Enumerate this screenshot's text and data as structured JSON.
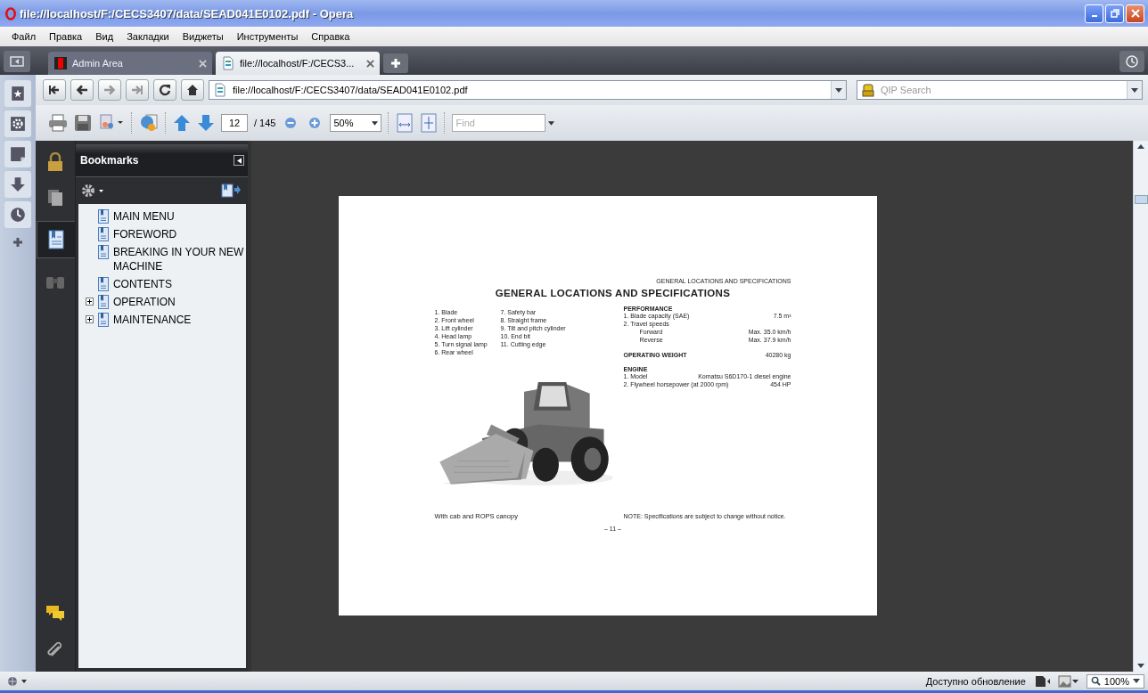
{
  "window": {
    "title": "file://localhost/F:/CECS3407/data/SEAD041E0102.pdf - Opera"
  },
  "menu": [
    "Файл",
    "Правка",
    "Вид",
    "Закладки",
    "Виджеты",
    "Инструменты",
    "Справка"
  ],
  "tabs": [
    {
      "label": "Admin Area",
      "selected": false
    },
    {
      "label": "file://localhost/F:/CECS3...",
      "selected": true
    }
  ],
  "address": {
    "value": "file://localhost/F:/CECS3407/data/SEAD041E0102.pdf"
  },
  "search": {
    "placeholder": "QIP Search"
  },
  "pdf_toolbar": {
    "page": "12",
    "total": "/ 145",
    "zoom": "50%",
    "find_placeholder": "Find"
  },
  "bookmarks": {
    "title": "Bookmarks",
    "items": [
      {
        "label": "MAIN MENU",
        "kind": "leaf"
      },
      {
        "label": "FOREWORD",
        "kind": "leaf"
      },
      {
        "label": "BREAKING IN YOUR NEW MACHINE",
        "kind": "leaf"
      },
      {
        "label": "CONTENTS",
        "kind": "leaf"
      },
      {
        "label": "OPERATION",
        "kind": "group",
        "expanded": false
      },
      {
        "label": "MAINTENANCE",
        "kind": "group",
        "expanded": false
      }
    ]
  },
  "document": {
    "running_head": "GENERAL LOCATIONS AND SPECIFICATIONS",
    "heading": "GENERAL LOCATIONS AND SPECIFICATIONS",
    "parts": [
      "1. Blade",
      "2. Front wheel",
      "3. Lift cylinder",
      "4. Head lamp",
      "5. Turn signal lamp",
      "6. Rear wheel",
      "7. Safety bar",
      "8. Straight frame",
      "9. Tilt and pitch cylinder",
      "10. End bit",
      "11. Cutting edge"
    ],
    "performance": {
      "heading": "PERFORMANCE",
      "rows": [
        {
          "label": "1. Blade capacity (SAE)",
          "value": "7.5 m³"
        },
        {
          "label": "2. Travel speeds",
          "children": [
            {
              "label": "Forward",
              "value": "Max. 35.0 km/h"
            },
            {
              "label": "Reverse",
              "value": "Max. 37.9 km/h"
            }
          ]
        }
      ]
    },
    "operating_weight": {
      "label": "OPERATING WEIGHT",
      "value": "40280 kg"
    },
    "engine": {
      "heading": "ENGINE",
      "rows": [
        {
          "label": "1. Model",
          "value": "Komatsu S6D170-1 diesel engine"
        },
        {
          "label": "2. Flywheel horsepower (at 2000 rpm)",
          "value": "454 HP"
        }
      ]
    },
    "caption": "With cab and ROPS canopy",
    "note": "NOTE:  Specifications are subject to change without notice.",
    "page_number": "– 11 –"
  },
  "status_bar": {
    "update": "Доступно обновление",
    "zoom": "100%"
  }
}
